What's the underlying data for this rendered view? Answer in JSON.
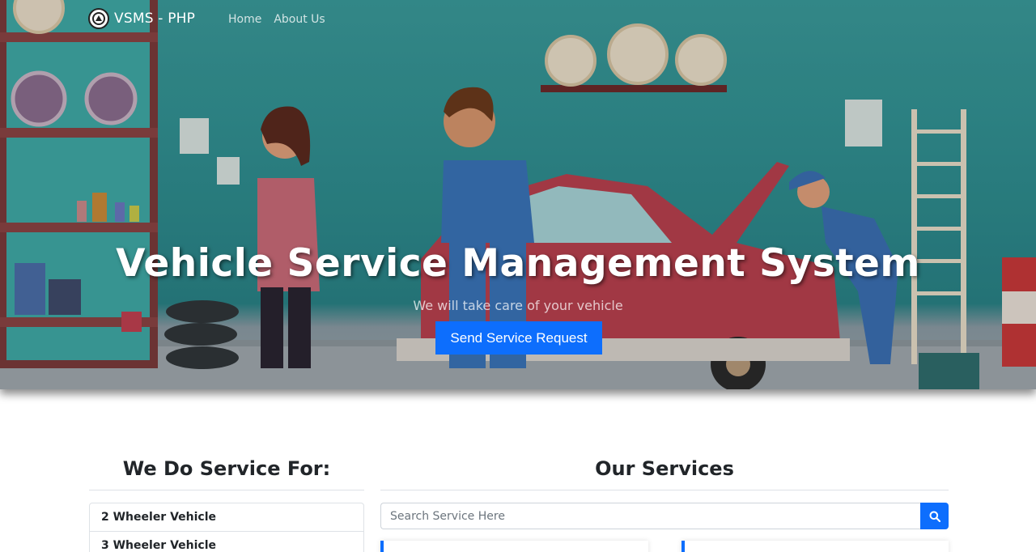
{
  "navbar": {
    "brand": "VSMS - PHP",
    "links": [
      "Home",
      "About Us"
    ]
  },
  "hero": {
    "title": "Vehicle Service Management System",
    "subtitle": "We will take care of your vehicle",
    "cta_label": "Send Service Request"
  },
  "service_for": {
    "title": "We Do Service For:",
    "items": [
      "2 Wheeler Vehicle",
      "3 Wheeler Vehicle"
    ]
  },
  "our_services": {
    "title": "Our Services",
    "search_placeholder": "Search Service Here"
  },
  "colors": {
    "primary": "#0d6efd",
    "hero_teal": "#2f8e90",
    "white": "#ffffff"
  },
  "icons": [
    "logo-icon",
    "search-icon"
  ]
}
